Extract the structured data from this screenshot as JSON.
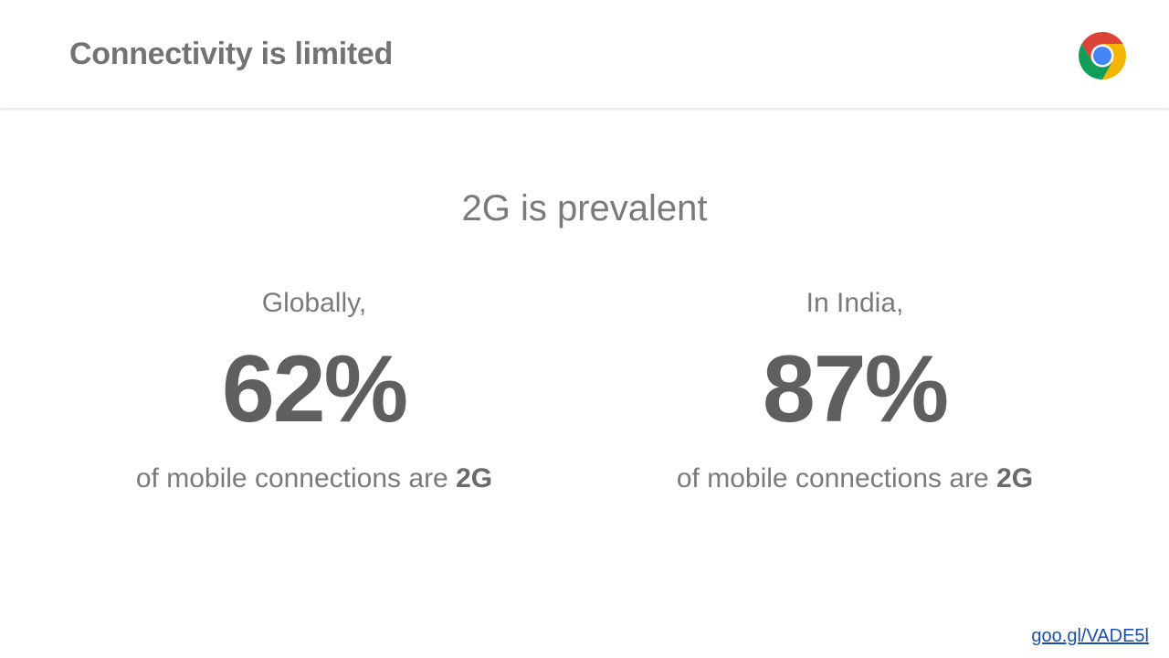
{
  "header": {
    "title": "Connectivity is limited",
    "logo_icon": "chrome-logo-icon"
  },
  "main": {
    "subtitle": "2G is prevalent",
    "stats": [
      {
        "label": "Globally,",
        "value": "62%",
        "caption_prefix": "of mobile connections are ",
        "caption_emphasis": "2G"
      },
      {
        "label": "In India,",
        "value": "87%",
        "caption_prefix": "of mobile connections are ",
        "caption_emphasis": "2G"
      }
    ]
  },
  "footer": {
    "link_text": "goo.gl/VADE5l"
  },
  "colors": {
    "text_gray": "#7a7a7a",
    "value_gray": "#5f5f5f",
    "link_blue": "#1a4fb4"
  }
}
